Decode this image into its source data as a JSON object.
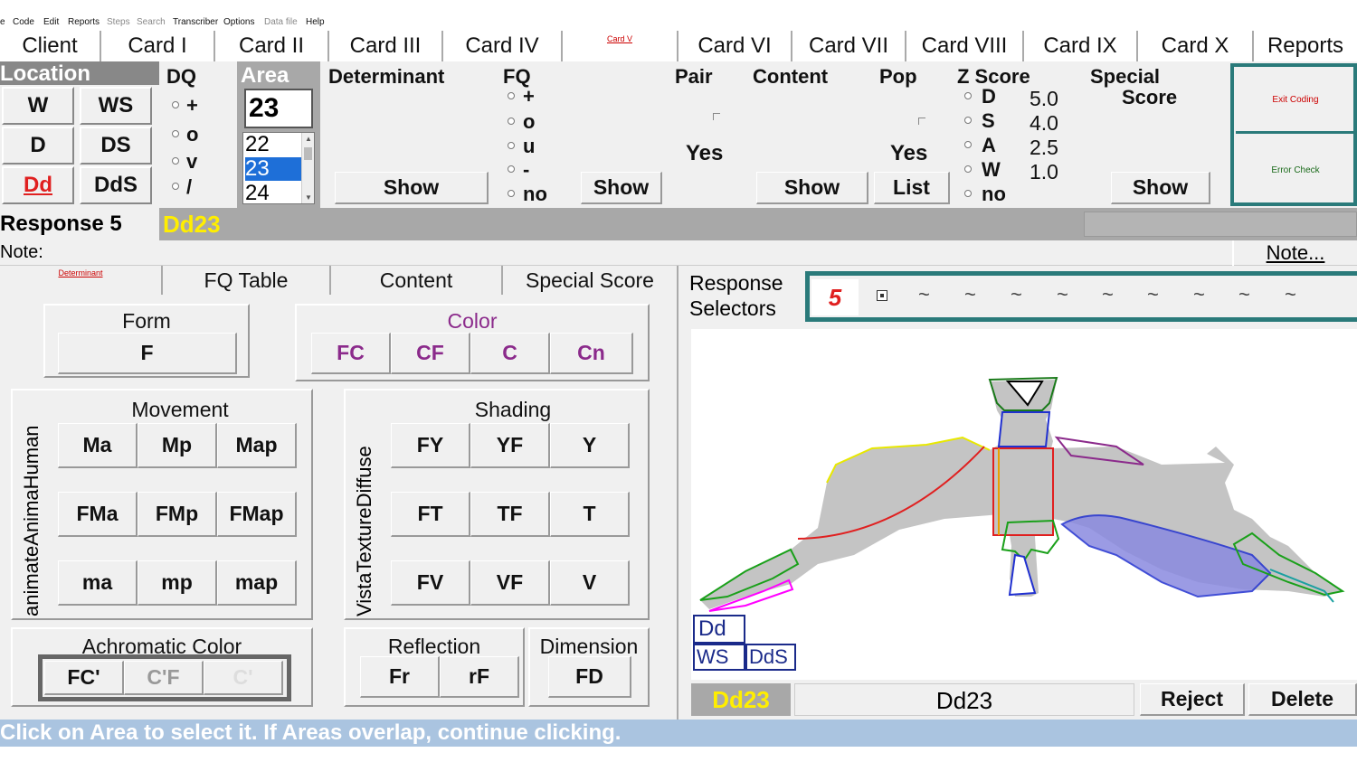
{
  "menu": [
    "e",
    "Code",
    "Edit",
    "Reports",
    "Steps",
    "Search",
    "Transcriber",
    "Options",
    "Data file",
    "Help"
  ],
  "tabs": [
    "Client",
    "Card I",
    "Card II",
    "Card III",
    "Card IV",
    "Card V",
    "Card VI",
    "Card VII",
    "Card VIII",
    "Card IX",
    "Card X",
    "Reports"
  ],
  "location": {
    "label": "Location",
    "buttons": [
      "W",
      "WS",
      "D",
      "DS",
      "Dd",
      "DdS"
    ],
    "active": "Dd"
  },
  "dq": {
    "label": "DQ",
    "options": [
      "+",
      "o",
      "v",
      "/"
    ]
  },
  "area": {
    "label": "Area",
    "value": "23",
    "list": [
      "22",
      "23",
      "24"
    ],
    "selected": "23"
  },
  "determinant": {
    "label": "Determinant",
    "show": "Show"
  },
  "fq": {
    "label": "FQ",
    "options": [
      "+",
      "o",
      "u",
      "-",
      "no"
    ],
    "show": "Show"
  },
  "pair": {
    "label": "Pair",
    "value": "Yes"
  },
  "content": {
    "label": "Content",
    "show": "Show"
  },
  "pop": {
    "label": "Pop",
    "value": "Yes",
    "list": "List"
  },
  "zscore": {
    "label": "Z Score",
    "options": [
      {
        "letter": "D",
        "value": "5.0"
      },
      {
        "letter": "S",
        "value": "4.0"
      },
      {
        "letter": "A",
        "value": "2.5"
      },
      {
        "letter": "W",
        "value": "1.0"
      },
      {
        "letter": "no",
        "value": ""
      }
    ]
  },
  "special": {
    "label1": "Special",
    "label2": "Score",
    "show": "Show"
  },
  "side_buttons": {
    "exit": "Exit Coding",
    "error": "Error Check"
  },
  "response": {
    "label": "Response 5",
    "code": "Dd23"
  },
  "note": {
    "label": "Note:",
    "button": "Note..."
  },
  "subtabs": [
    "Determinant",
    "FQ Table",
    "Content",
    "Special Score"
  ],
  "form": {
    "title": "Form",
    "buttons": [
      "F"
    ]
  },
  "color": {
    "title": "Color",
    "buttons": [
      "FC",
      "CF",
      "C",
      "Cn"
    ],
    "accent": "#8b2a8b"
  },
  "movement": {
    "title": "Movement",
    "side": "animateAnimaHuman",
    "rows": [
      [
        "Ma",
        "Mp",
        "Map"
      ],
      [
        "FMa",
        "FMp",
        "FMap"
      ],
      [
        "ma",
        "mp",
        "map"
      ]
    ]
  },
  "shading": {
    "title": "Shading",
    "side": "VistaTextureDiffuse",
    "rows": [
      [
        "FY",
        "YF",
        "Y"
      ],
      [
        "FT",
        "TF",
        "T"
      ],
      [
        "FV",
        "VF",
        "V"
      ]
    ]
  },
  "achromatic": {
    "title": "Achromatic Color",
    "buttons": [
      "FC'",
      "C'F",
      "C'"
    ]
  },
  "reflection": {
    "title": "Reflection",
    "buttons": [
      "Fr",
      "rF"
    ]
  },
  "dimension": {
    "title": "Dimension",
    "buttons": [
      "FD"
    ]
  },
  "selectors": {
    "label1": "Response",
    "label2": "Selectors",
    "current": "5",
    "slots": [
      "~",
      "~",
      "~",
      "~",
      "~",
      "~",
      "~",
      "~",
      "~"
    ]
  },
  "legend": {
    "top": "Dd",
    "bottom_left": "WS",
    "bottom_right": "DdS"
  },
  "bottom": {
    "code": "Dd23",
    "display": "Dd23",
    "reject": "Reject",
    "delete": "Delete"
  },
  "status": "Click on Area to select it.  If Areas overlap, continue clicking."
}
